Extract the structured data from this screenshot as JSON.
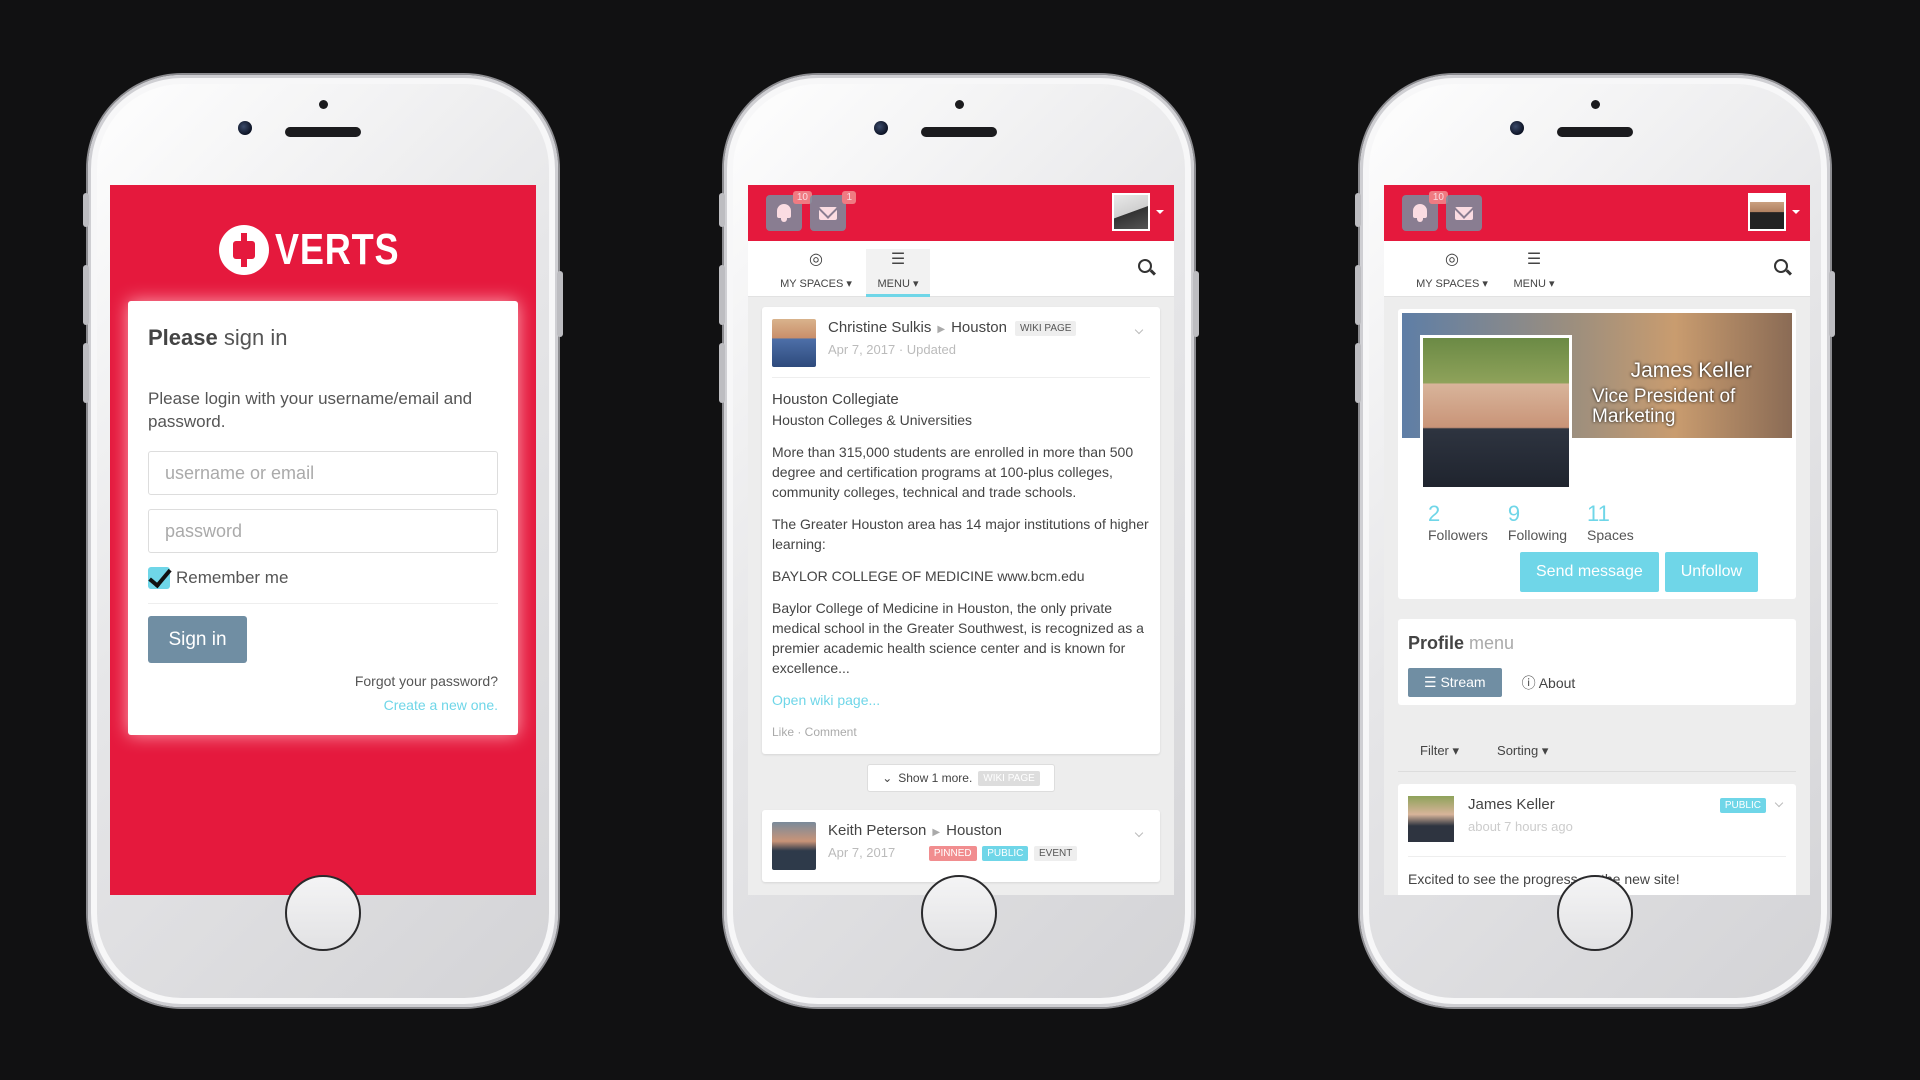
{
  "login": {
    "brand": "VERTS",
    "heading_bold": "Please",
    "heading_rest": "sign in",
    "intro": "Please login with your username/email and password.",
    "username_placeholder": "username or email",
    "password_placeholder": "password",
    "remember": "Remember me",
    "signin_label": "Sign in",
    "forgot": "Forgot your password?",
    "create": "Create a new one."
  },
  "header": {
    "notifications_badge": "10",
    "messages_badge": "1",
    "my_spaces": "MY SPACES",
    "menu": "MENU"
  },
  "feed": {
    "post1": {
      "author": "Christine Sulkis",
      "space": "Houston",
      "tag": "WIKI PAGE",
      "date": "Apr 7, 2017 · Updated",
      "title": "Houston Collegiate",
      "subtitle": "Houston Colleges & Universities",
      "p1": "More than 315,000 students are enrolled in more than 500 degree and certification programs at 100-plus colleges, community colleges, technical and trade schools.",
      "p2": "The Greater Houston area has 14 major institutions of higher learning:",
      "p3": "BAYLOR COLLEGE OF MEDICINE www.bcm.edu",
      "p4": "Baylor College of Medicine in Houston, the only private medical school in the Greater Southwest, is recognized as a premier academic health science center and is known for excellence...",
      "link": "Open wiki page...",
      "actions": "Like · Comment"
    },
    "show_more": "Show 1 more.",
    "show_more_tag": "WIKI PAGE",
    "post2": {
      "author": "Keith Peterson",
      "space": "Houston",
      "date": "Apr 7, 2017",
      "tag_pinned": "PINNED",
      "tag_public": "PUBLIC",
      "tag_event": "EVENT"
    }
  },
  "profile": {
    "name": "James Keller",
    "title": "Vice President of Marketing",
    "stats": [
      {
        "value": "2",
        "label": "Followers"
      },
      {
        "value": "9",
        "label": "Following"
      },
      {
        "value": "11",
        "label": "Spaces"
      }
    ],
    "send_message": "Send message",
    "unfollow": "Unfollow",
    "menu_bold": "Profile",
    "menu_rest": "menu",
    "stream": "Stream",
    "about": "About",
    "filter": "Filter",
    "sorting": "Sorting",
    "post_author": "James Keller",
    "post_time": "about 7 hours ago",
    "post_tag": "PUBLIC",
    "post_text": "Excited to see the progress on the new site!"
  },
  "colors": {
    "brand_red": "#e5193d",
    "accent_cyan": "#6fd6e8",
    "button_slate": "#708ea3"
  }
}
